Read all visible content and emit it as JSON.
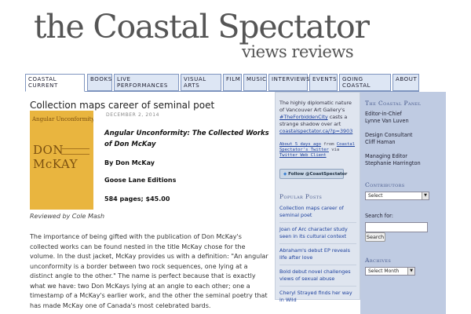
{
  "site": {
    "title": "the Coastal Spectator",
    "subtitle": "views reviews"
  },
  "nav": {
    "items": [
      {
        "label": "COASTAL CURRENT"
      },
      {
        "label": "BOOKS"
      },
      {
        "label": "LIVE PERFORMANCES"
      },
      {
        "label": "VISUAL ARTS"
      },
      {
        "label": "FILM"
      },
      {
        "label": "MUSIC"
      },
      {
        "label": "INTERVIEWS"
      },
      {
        "label": "EVENTS"
      },
      {
        "label": "GOING COASTAL"
      },
      {
        "label": "ABOUT"
      }
    ]
  },
  "post": {
    "title": "Collection maps career of seminal poet",
    "date": "DECEMBER 2, 2014",
    "cover_title": "Angular Unconformity",
    "cover_author": "DON McKAY",
    "book_title": "Angular Unconformity: The Collected Works of Don McKay",
    "book_author": "By Don McKay",
    "book_publisher": "Goose Lane Editions",
    "book_details": "584 pages; $45.00",
    "reviewed_by": "Reviewed by Cole Mash",
    "body": "The importance of being gifted with the publication of Don McKay's collected works can be found nested in the title McKay chose for the volume. In the dust jacket, McKay provides us with a definition: \"An angular unconformity is a border between two rock sequences, one lying at a distinct angle to the other.\" The name is perfect because that is exactly what we have: two Don McKays lying at an angle to each other; one a timestamp of a McKay's earlier work, and the other the seminal poetry that has made McKay one of Canada's most celebrated bards."
  },
  "twitter": {
    "tweet_text": "The highly diplomatic nature of Vancouver Art Gallery's",
    "tweet_hashtag": "#TheForbiddenCity",
    "tweet_text2": "casts a strange shadow over art",
    "tweet_link": "coastalspectator.ca/?p=3903",
    "meta_time": "About 5 days ago",
    "meta_from": "from",
    "meta_source": "Coastal Spectator's Twitter",
    "meta_via": "via",
    "meta_client": "Twitter Web Client",
    "follow_label": "Follow @CoastSpectator"
  },
  "popular": {
    "heading": "Popular Posts",
    "items": [
      {
        "label": "Collection maps career of seminal poet"
      },
      {
        "label": "Joan of Arc character study seen in its cultural context"
      },
      {
        "label": "Abraham's debut EP reveals life after love"
      },
      {
        "label": "Bold debut novel challenges views of sexual abuse"
      },
      {
        "label": "Cheryl Strayed finds her way in Wild"
      }
    ]
  },
  "panel": {
    "heading": "The Coastal Panel",
    "role1": "Editor-in-Chief",
    "name1": "Lynne Van Luven",
    "role2": "Design Consultant",
    "name2": "Cliff Haman",
    "role3": "Managing Editor",
    "name3": "Stephanie Harrington",
    "contributors_heading": "Contributors",
    "contributors_select": "Select",
    "search_label": "Search for:",
    "search_button": "Search",
    "archives_heading": "Archives",
    "archives_select": "Select Month"
  }
}
